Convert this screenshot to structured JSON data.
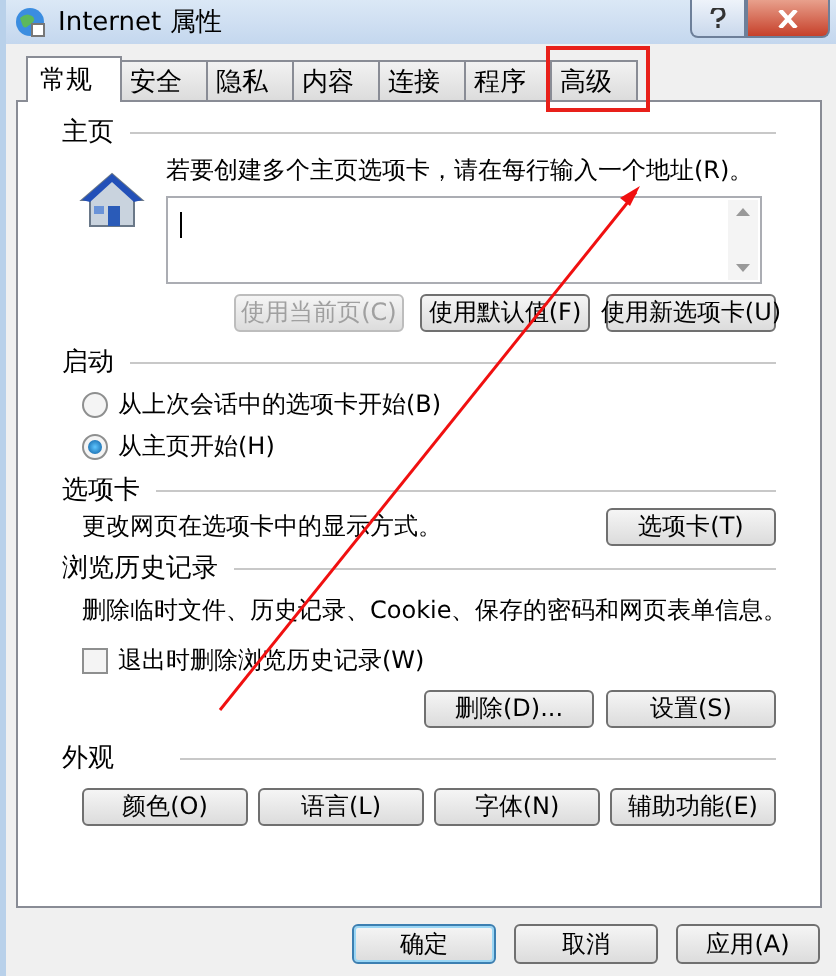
{
  "window": {
    "title": "Internet 属性"
  },
  "tabs": [
    {
      "label": "常规",
      "selected": true
    },
    {
      "label": "安全",
      "selected": false
    },
    {
      "label": "隐私",
      "selected": false
    },
    {
      "label": "内容",
      "selected": false
    },
    {
      "label": "连接",
      "selected": false
    },
    {
      "label": "程序",
      "selected": false
    },
    {
      "label": "高级",
      "selected": false
    }
  ],
  "home_page": {
    "heading": "主页",
    "instruction": "若要创建多个主页选项卡，请在每行输入一个地址(R)。",
    "buttons": [
      {
        "label": "使用当前页(C)",
        "disabled": true
      },
      {
        "label": "使用默认值(F)",
        "disabled": false
      },
      {
        "label": "使用新选项卡(U)",
        "disabled": false
      }
    ]
  },
  "startup": {
    "heading": "启动",
    "options": [
      {
        "label": "从上次会话中的选项卡开始(B)",
        "selected": false
      },
      {
        "label": "从主页开始(H)",
        "selected": true
      }
    ]
  },
  "tabs_section": {
    "heading": "选项卡",
    "description": "更改网页在选项卡中的显示方式。",
    "button": "选项卡(T)"
  },
  "history": {
    "heading": "浏览历史记录",
    "description": "删除临时文件、历史记录、Cookie、保存的密码和网页表单信息。",
    "checkbox": {
      "label": "退出时删除浏览历史记录(W)",
      "checked": false
    },
    "buttons": [
      "删除(D)...",
      "设置(S)"
    ]
  },
  "appearance": {
    "heading": "外观",
    "buttons": [
      "颜色(O)",
      "语言(L)",
      "字体(N)",
      "辅助功能(E)"
    ]
  },
  "footer_buttons": [
    {
      "label": "确定",
      "default": true
    },
    {
      "label": "取消",
      "default": false
    },
    {
      "label": "应用(A)",
      "default": false
    }
  ]
}
